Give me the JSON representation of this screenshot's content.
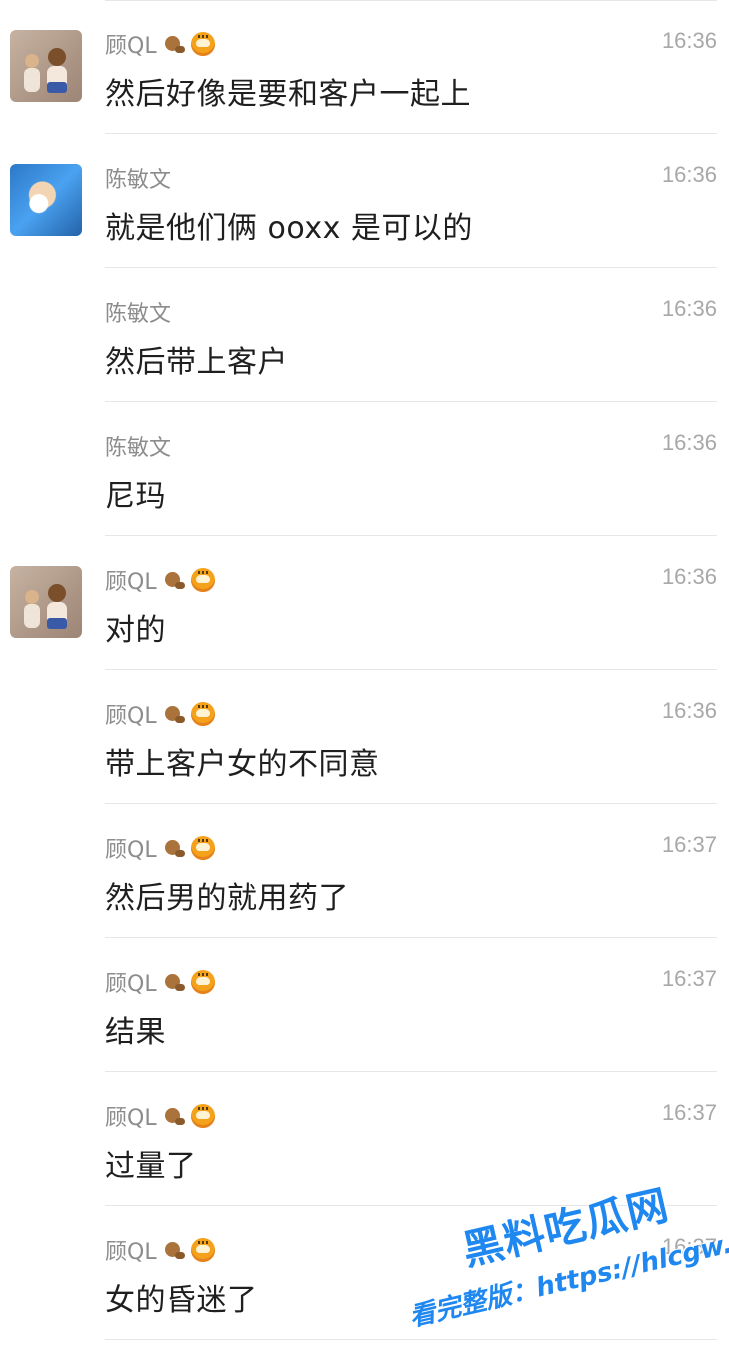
{
  "messages": [
    {
      "sender": "顾QL",
      "time": "16:36",
      "text": "然后好像是要和客户一起上",
      "show_avatar": true,
      "avatar": "kids-photo-avatar",
      "emoji": [
        "monkey-icon",
        "tiger-icon"
      ]
    },
    {
      "sender": "陈敏文",
      "time": "16:36",
      "text": "就是他们俩 ooxx 是可以的",
      "show_avatar": true,
      "avatar": "cartoon-avatar",
      "emoji": []
    },
    {
      "sender": "陈敏文",
      "time": "16:36",
      "text": "然后带上客户",
      "show_avatar": false,
      "emoji": []
    },
    {
      "sender": "陈敏文",
      "time": "16:36",
      "text": "尼玛",
      "show_avatar": false,
      "emoji": []
    },
    {
      "sender": "顾QL",
      "time": "16:36",
      "text": "对的",
      "show_avatar": true,
      "avatar": "kids-photo-avatar",
      "emoji": [
        "monkey-icon",
        "tiger-icon"
      ]
    },
    {
      "sender": "顾QL",
      "time": "16:36",
      "text": "带上客户女的不同意",
      "show_avatar": false,
      "emoji": [
        "monkey-icon",
        "tiger-icon"
      ]
    },
    {
      "sender": "顾QL",
      "time": "16:37",
      "text": "然后男的就用药了",
      "show_avatar": false,
      "emoji": [
        "monkey-icon",
        "tiger-icon"
      ]
    },
    {
      "sender": "顾QL",
      "time": "16:37",
      "text": "结果",
      "show_avatar": false,
      "emoji": [
        "monkey-icon",
        "tiger-icon"
      ]
    },
    {
      "sender": "顾QL",
      "time": "16:37",
      "text": "过量了",
      "show_avatar": false,
      "emoji": [
        "monkey-icon",
        "tiger-icon"
      ]
    },
    {
      "sender": "顾QL",
      "time": "16:37",
      "text": "女的昏迷了",
      "show_avatar": false,
      "emoji": [
        "monkey-icon",
        "tiger-icon"
      ]
    }
  ],
  "watermark": {
    "title": "黑料吃瓜网",
    "url": "看完整版：https://hlcgw.co"
  },
  "colors": {
    "background": "#ffffff",
    "message_text": "#1f1f1f",
    "meta_text": "#8c8c8c",
    "divider": "#e6e6e6",
    "watermark": "#1e87f0"
  }
}
